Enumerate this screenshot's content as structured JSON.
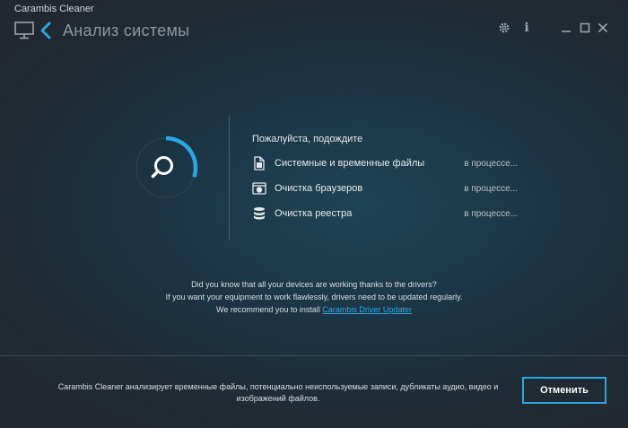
{
  "window": {
    "app_name": "Carambis Cleaner",
    "title": "Анализ системы"
  },
  "titlebar_icons": [
    "monitor-icon",
    "back-icon",
    "gear-icon",
    "info-icon",
    "minimize-icon",
    "maximize-icon",
    "close-icon"
  ],
  "scan": {
    "heading": "Пожалуйста, подождите",
    "progress_fraction": 0.3,
    "tasks": [
      {
        "icon": "document-icon",
        "label": "Системные и временные файлы",
        "status": "в процессе..."
      },
      {
        "icon": "browser-icon",
        "label": "Очистка браузеров",
        "status": "в процессе..."
      },
      {
        "icon": "database-icon",
        "label": "Очистка реестра",
        "status": "в процессе..."
      }
    ]
  },
  "tips": {
    "line1": "Did you know that all your devices are working thanks to the drivers?",
    "line2": "If you want your equipment to work flawlessly, drivers need to be updated regularly.",
    "line3_prefix": "We recommend you to install ",
    "link": "Carambis Driver Updater"
  },
  "footer": {
    "description": "Carambis Cleaner анализирует временные файлы, потенциально неиспользуемые записи, дубликаты аудио, видео и изображений файлов.",
    "cancel_label": "Отменить"
  },
  "colors": {
    "accent": "#2aa7e0",
    "background": "#1e3240"
  }
}
